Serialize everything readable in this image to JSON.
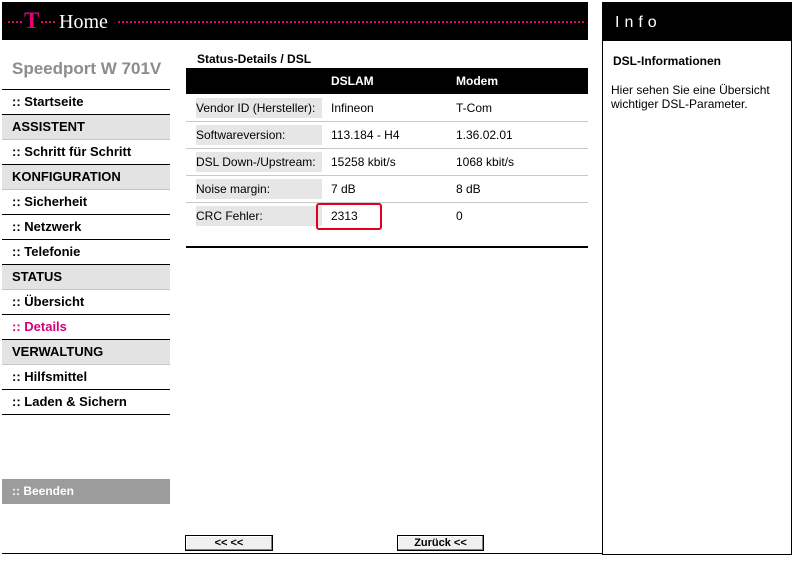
{
  "header": {
    "brand_t": "T",
    "brand_home": "Home"
  },
  "sidebar": {
    "device_title": "Speedport W 701V",
    "items": [
      {
        "label": ":: Startseite"
      },
      {
        "label": "ASSISTENT"
      },
      {
        "label": ":: Schritt für Schritt"
      },
      {
        "label": "KONFIGURATION"
      },
      {
        "label": ":: Sicherheit"
      },
      {
        "label": ":: Netzwerk"
      },
      {
        "label": ":: Telefonie"
      },
      {
        "label": "STATUS"
      },
      {
        "label": ":: Übersicht"
      },
      {
        "label": ":: Details"
      },
      {
        "label": "VERWALTUNG"
      },
      {
        "label": ":: Hilfsmittel"
      },
      {
        "label": ":: Laden & Sichern"
      }
    ],
    "logout_label": ":: Beenden"
  },
  "main": {
    "page_title": "Status-Details / DSL",
    "columns": [
      "DSLAM",
      "Modem"
    ],
    "rows": [
      {
        "label": "Vendor ID (Hersteller):",
        "dslam": "Infineon",
        "modem": "T-Com"
      },
      {
        "label": "Softwareversion:",
        "dslam": "113.184 - H4",
        "modem": "1.36.02.01"
      },
      {
        "label": "DSL Down-/Upstream:",
        "dslam": "15258 kbit/s",
        "modem": "1068 kbit/s"
      },
      {
        "label": "Noise margin:",
        "dslam": "7 dB",
        "modem": "8 dB"
      },
      {
        "label": "CRC Fehler:",
        "dslam": "2313",
        "modem": "0"
      }
    ],
    "prev_button": "<<  <<",
    "back_button": "Zurück <<"
  },
  "info": {
    "heading": "Info",
    "title": "DSL-Informationen",
    "text": "Hier sehen Sie eine Übersicht wichtiger DSL-Parameter."
  },
  "colors": {
    "brand_magenta": "#e20074",
    "highlight_red": "#e3001b"
  }
}
